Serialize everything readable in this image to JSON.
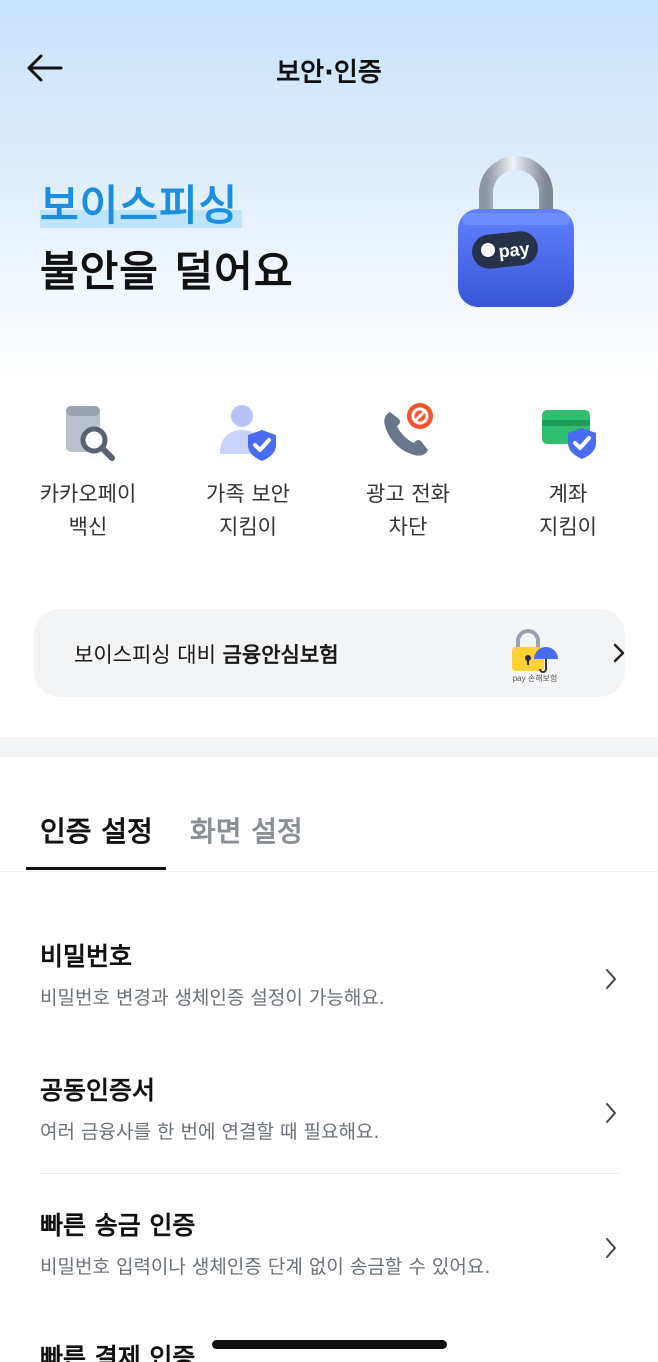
{
  "header": {
    "title": "보안·인증"
  },
  "hero": {
    "line1": "보이스피싱",
    "line2": "불안을 덜어요",
    "lock_badge": "pay"
  },
  "quick_menu": [
    {
      "label": "카카오페이\n백신",
      "icon": "search-document-icon"
    },
    {
      "label": "가족 보안\n지킴이",
      "icon": "family-shield-icon"
    },
    {
      "label": "광고 전화\n차단",
      "icon": "phone-block-icon"
    },
    {
      "label": "계좌\n지킴이",
      "icon": "account-shield-icon"
    }
  ],
  "insurance": {
    "prefix": "보이스피싱 대비 ",
    "highlight": "금융안심보험",
    "icon_caption": "pay 손해보험"
  },
  "tabs": [
    {
      "label": "인증 설정",
      "active": true
    },
    {
      "label": "화면 설정",
      "active": false
    }
  ],
  "settings": [
    {
      "title": "비밀번호",
      "desc": "비밀번호 변경과 생체인증 설정이 가능해요."
    },
    {
      "title": "공동인증서",
      "desc": "여러 금융사를 한 번에 연결할 때 필요해요."
    },
    {
      "title": "빠른 송금 인증",
      "desc": "비밀번호 입력이나 생체인증 단계 없이 송금할 수 있어요."
    },
    {
      "title": "빠른 결제 인증",
      "desc": ""
    }
  ],
  "colors": {
    "accent_blue": "#1a8fe0",
    "shield_blue": "#4a6cf0",
    "card_bg": "#f2f4f6"
  }
}
